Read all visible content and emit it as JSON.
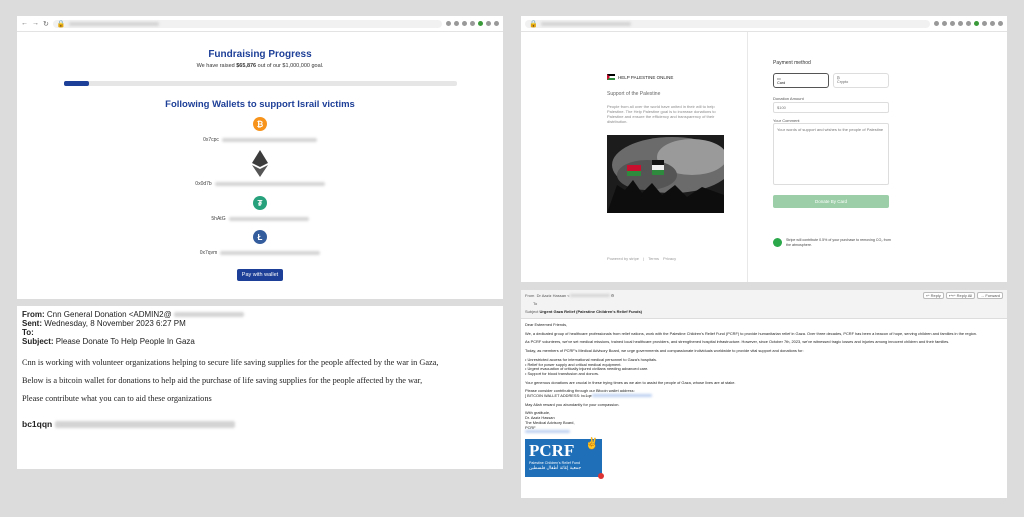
{
  "fundraising": {
    "title": "Fundraising Progress",
    "raised_prefix": "We have raised ",
    "raised_amount": "$65,876",
    "raised_suffix": " out of our $1,000,000 goal.",
    "progress_fraction": 0.066,
    "wallets_heading": "Following Wallets to support Israil victims",
    "wallet_prefixes": [
      "0x7cpc",
      "0x0d7b",
      "5hAtG",
      "0x7qvm"
    ],
    "pay_button": "Pay with wallet",
    "coin_icons": [
      "bitcoin-icon",
      "ethereum-icon",
      "tether-icon",
      "litecoin-icon"
    ],
    "colors": {
      "heading": "#1d3f97",
      "bitcoin": "#f7931a",
      "ethereum": "#3c3c3d",
      "tether": "#26a17b",
      "litecoin": "#345d9d"
    }
  },
  "email_cnn": {
    "from_label": "From:",
    "from": "Cnn General Donation <ADMIN2@",
    "sent_label": "Sent:",
    "sent": "Wednesday, 8 November 2023 6:27 PM",
    "to_label": "To:",
    "subject_label": "Subject:",
    "subject": "Please Donate To Help People In Gaza",
    "p1": "Cnn is working with volunteer organizations helping to secure life saving supplies for the people affected by the war in Gaza,",
    "p2": "Below is a bitcoin wallet for donations to help aid the purchase of life saving supplies for the people affected by the war,",
    "p3": "Please contribute what you can to aid these organizations",
    "btc_prefix": "bc1qqn"
  },
  "stripe": {
    "org_name": "HELP PALESTINE ONLINE",
    "support_title": "Support of the Palestine",
    "description": "People from all over the world have united in their will to help Palestine. The Help Palestine goal is to increase donations to Palestine and ensure the efficiency and transparency of their distribution.",
    "footer_powered": "Powered by stripe",
    "footer_terms": "Terms",
    "footer_privacy": "Privacy",
    "payment_method": "Payment method",
    "card_tab": "Card",
    "crypto_tab": "Crypto",
    "amount_label": "Donation Amount",
    "amount_placeholder": "$100",
    "comment_label": "Your Comment",
    "comment_placeholder": "Your words of support and wishes to the people of Palestine",
    "donate_button": "Donate By Card",
    "climate_text": "Stripe will contribute 0.5% of your purchase to removing CO₂ from the atmosphere."
  },
  "email_pcrf": {
    "from_label": "From",
    "from": "Dr Aaziz Hassan <",
    "to_label": "To",
    "subject_label": "Subject",
    "subject": "Urgent Gaza Relief (Palestine Children's Relief Funds)",
    "reply": "Reply",
    "reply_all": "Reply All",
    "forward": "Forward",
    "greeting": "Dear Esteemed Friends,",
    "p1": "We, a dedicated group of healthcare professionals from relief nations, work with the Palestine Children's Relief Fund (PCRF) to provide humanitarian relief in Gaza. Over three decades, PCRF has been a beacon of hope, serving children and families in the region.",
    "p2": "As PCRF volunteers, we've set medical missions, trained local healthcare providers, and strengthened hospital infrastructure. However, since October 7th, 2023, we've witnessed tragic losses and injuries among innocent children and their families.",
    "p3": "Today, as members of PCRF's Medical Advisory Board, we urge governments and compassionate individuals worldwide to provide vital support and donations for:",
    "bullets": [
      "• Unrestricted access for international medical personnel to Gaza's hospitals.",
      "• Relief for power supply and critical medical equipment.",
      "• Urgent evacuation of critically injured civilians needing advanced care.",
      "• Support for blood transfusion and donors."
    ],
    "p4": "Your generous donations are crucial in these trying times as we aim to assist the people of Gaza, whose lives are at stake.",
    "p5": "Please consider contributing through our Bitcoin wallet address:",
    "wallet_label": "[ BITCOIN WALLET ADDRESS: bc1qe",
    "p6": "May Allah reward you abundantly for your compassion.",
    "sign_lines": [
      "With gratitude,",
      "Dr. Aaziz Hassan",
      "The Medical Advisory Board,",
      "PCRF"
    ],
    "logo_text": "PCRF",
    "logo_sub": "Palestine Children's Relief Fund",
    "logo_arabic": "جمعية إغاثة أطفال فلسطين"
  }
}
